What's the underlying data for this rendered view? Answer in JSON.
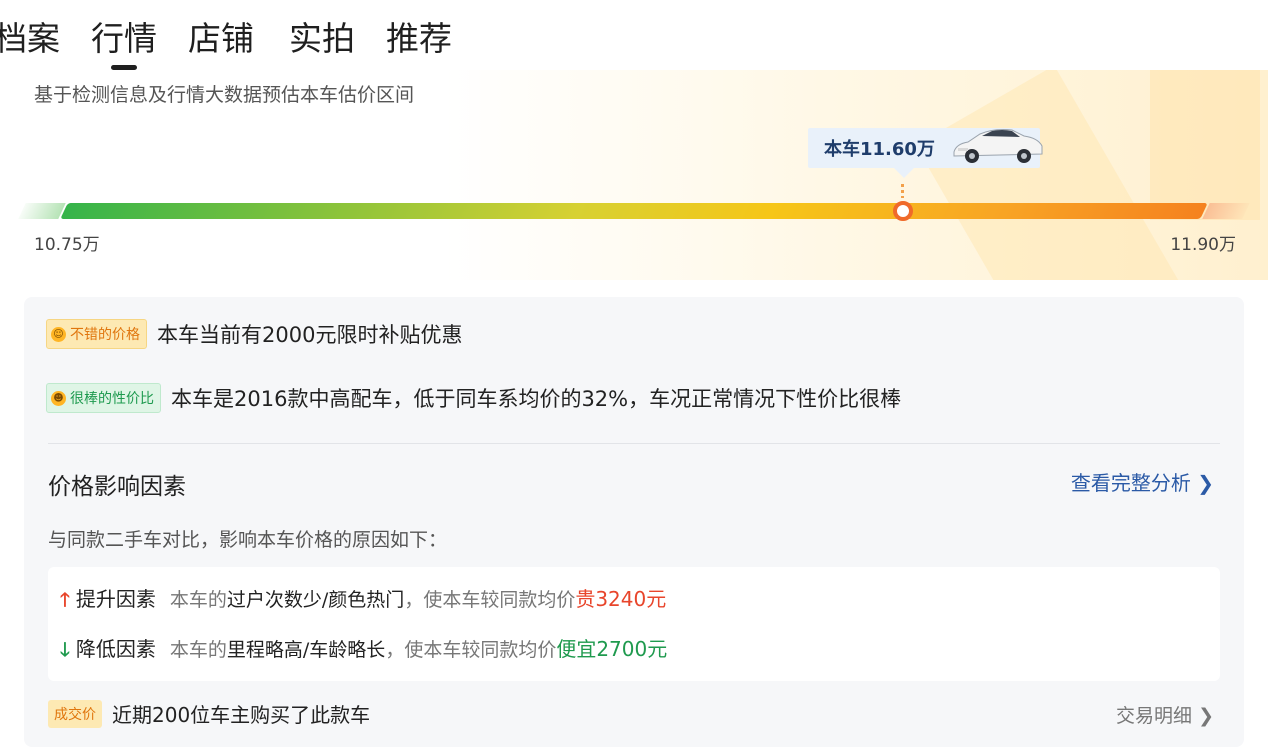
{
  "tabs": [
    {
      "label": "档案",
      "active": false
    },
    {
      "label": "行情",
      "active": true
    },
    {
      "label": "店铺",
      "active": false
    },
    {
      "label": "实拍",
      "active": false
    },
    {
      "label": "推荐",
      "active": false
    }
  ],
  "estimate": {
    "subtitle": "基于检测信息及行情大数据预估本车估价区间",
    "current_price_label": "本车11.60万",
    "min_label": "10.75万",
    "max_label": "11.90万",
    "min_value": 10.75,
    "max_value": 11.9,
    "current_value": 11.6
  },
  "highlights": [
    {
      "badge": "不错的价格",
      "text": "本车当前有2000元限时补贴优惠"
    },
    {
      "badge": "很棒的性价比",
      "text": "本车是2016款中高配车，低于同车系均价的32%，车况正常情况下性价比很棒"
    }
  ],
  "factors": {
    "title": "价格影响因素",
    "link": "查看完整分析 ❯",
    "desc": "与同款二手车对比，影响本车价格的原因如下：",
    "up": {
      "name": "提升因素",
      "prefix": "本车的",
      "items": "过户次数少/颜色热门",
      "suffix": "，使本车较同款均价",
      "value": "贵3240元"
    },
    "down": {
      "name": "降低因素",
      "prefix": "本车的",
      "items": "里程略高/车龄略长",
      "suffix": "，使本车较同款均价",
      "value": "便宜2700元"
    }
  },
  "deal": {
    "badge": "成交价",
    "text": "近期200位车主购买了此款车",
    "link": "交易明细 ❯"
  },
  "colors": {
    "accent_up": "#e8452b",
    "accent_down": "#1f9a4e",
    "link": "#2b5aa6",
    "marker": "#f06a2a"
  }
}
